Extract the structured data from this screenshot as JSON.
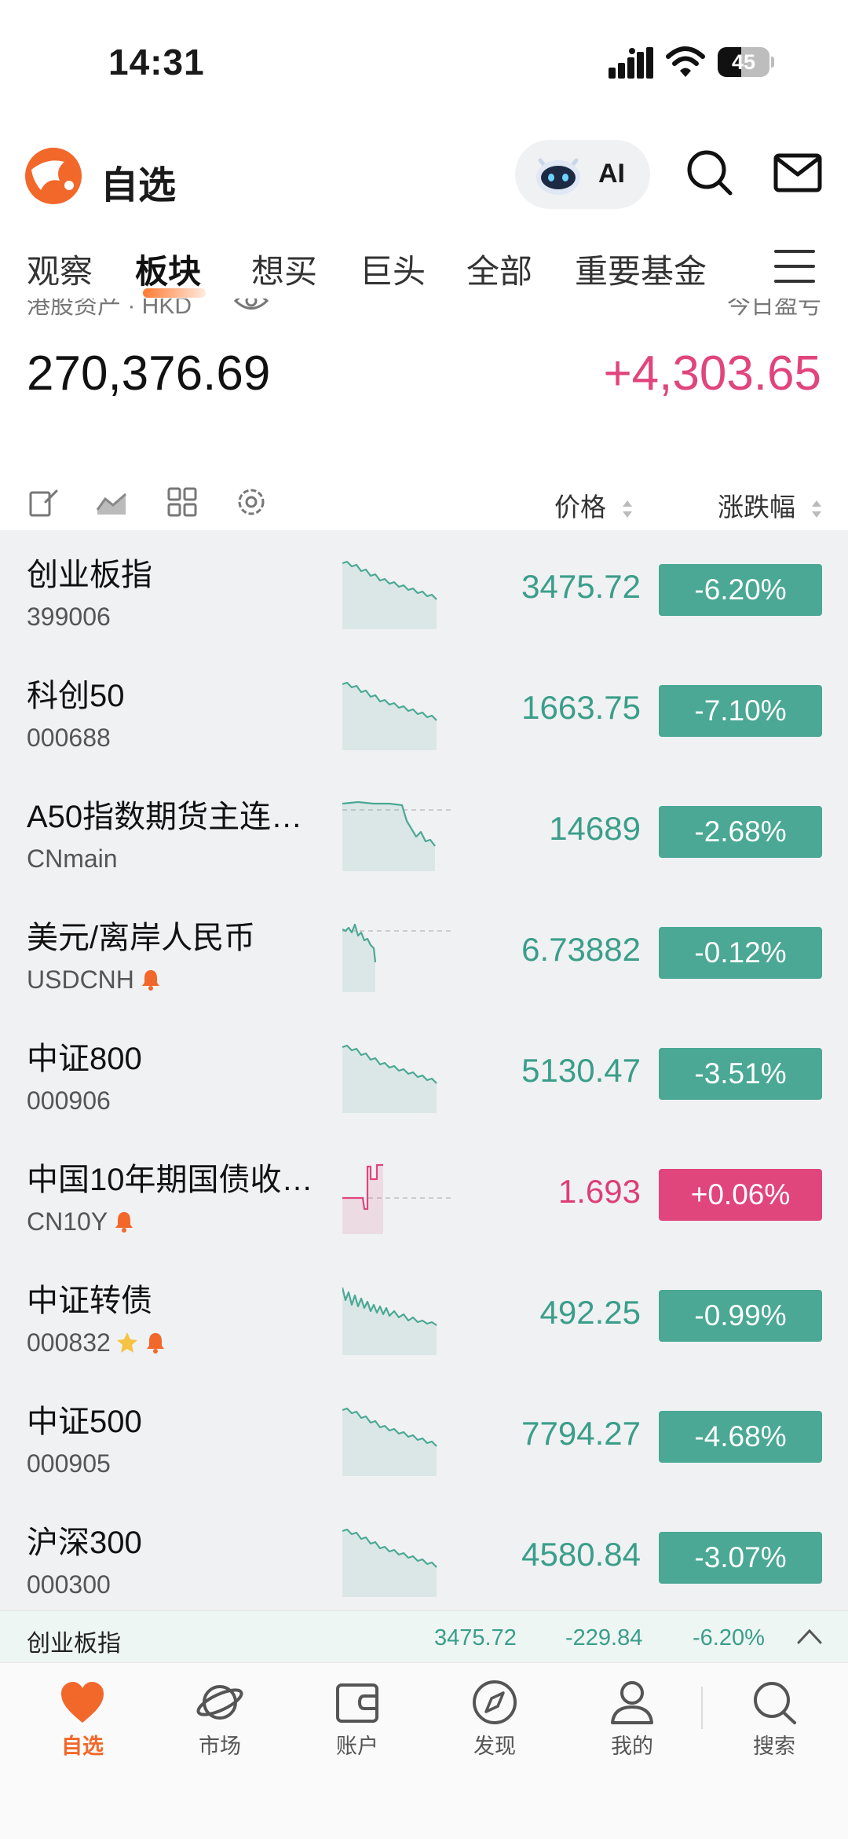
{
  "status_bar": {
    "time": "14:31",
    "battery": "45",
    "battery_level": 0.45
  },
  "header": {
    "title": "自选",
    "ai_label": "AI"
  },
  "tabs": [
    {
      "label": "观察"
    },
    {
      "label": "板块",
      "active": true
    },
    {
      "label": "想买"
    },
    {
      "label": "巨头"
    },
    {
      "label": "全部"
    },
    {
      "label": "重要基金"
    }
  ],
  "asset": {
    "label": "港股资产 · HKD",
    "amount": "270,376.69",
    "pnl_label": "今日盈亏",
    "pnl": "+4,303.65"
  },
  "columns": {
    "price": "价格",
    "change": "涨跌幅"
  },
  "rows": [
    {
      "name": "创业板指",
      "code": "399006",
      "price": "3475.72",
      "change": "-6.20%",
      "dir": "down",
      "trend": "down"
    },
    {
      "name": "科创50",
      "code": "000688",
      "price": "1663.75",
      "change": "-7.10%",
      "dir": "down",
      "trend": "down"
    },
    {
      "name": "A50指数期货主连…",
      "code": "CNmain",
      "price": "14689",
      "change": "-2.68%",
      "dir": "down",
      "trend": "flat-drop"
    },
    {
      "name": "美元/离岸人民币",
      "code": "USDCNH",
      "price": "6.73882",
      "change": "-0.12%",
      "dir": "down",
      "trend": "short-drop",
      "alert": true
    },
    {
      "name": "中证800",
      "code": "000906",
      "price": "5130.47",
      "change": "-3.51%",
      "dir": "down",
      "trend": "down"
    },
    {
      "name": "中国10年期国债收…",
      "code": "CN10Y",
      "price": "1.693",
      "change": "+0.06%",
      "dir": "up",
      "trend": "step-up",
      "alert": true
    },
    {
      "name": "中证转债",
      "code": "000832",
      "price": "492.25",
      "change": "-0.99%",
      "dir": "down",
      "trend": "noisy-down",
      "star": true,
      "alert": true
    },
    {
      "name": "中证500",
      "code": "000905",
      "price": "7794.27",
      "change": "-4.68%",
      "dir": "down",
      "trend": "down"
    },
    {
      "name": "沪深300",
      "code": "000300",
      "price": "4580.84",
      "change": "-3.07%",
      "dir": "down",
      "trend": "down"
    }
  ],
  "ticker": {
    "name": "创业板指",
    "price": "3475.72",
    "delta": "-229.84",
    "change": "-6.20%"
  },
  "nav": [
    {
      "label": "自选",
      "icon": "heart-icon",
      "active": true
    },
    {
      "label": "市场",
      "icon": "planet-icon"
    },
    {
      "label": "账户",
      "icon": "wallet-icon"
    },
    {
      "label": "发现",
      "icon": "compass-icon"
    },
    {
      "label": "我的",
      "icon": "person-icon"
    },
    {
      "label": "搜索",
      "icon": "search-icon"
    }
  ],
  "colors": {
    "up": "#e0457b",
    "down": "#4aa894",
    "accent": "#f2682a"
  }
}
